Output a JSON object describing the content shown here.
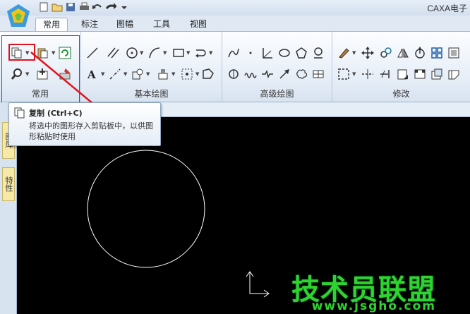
{
  "window": {
    "title": "CAXA电子",
    "quick_access": [
      "new-icon",
      "open-icon",
      "save-icon",
      "print-icon",
      "undo-icon",
      "redo-icon",
      "customize-icon"
    ]
  },
  "tabs": [
    {
      "label": "常用",
      "active": true
    },
    {
      "label": "标注"
    },
    {
      "label": "图幅"
    },
    {
      "label": "工具"
    },
    {
      "label": "视图"
    }
  ],
  "ribbon": {
    "groups": [
      {
        "label": "常用"
      },
      {
        "label": "基本绘图"
      },
      {
        "label": "高级绘图"
      },
      {
        "label": "修改"
      }
    ]
  },
  "tooltip": {
    "title": "复制 (Ctrl+C)",
    "description": "将选中的图形存入剪贴板中，以供图形粘贴时使用"
  },
  "sidebar": {
    "tabs": [
      "图库",
      "特性"
    ]
  },
  "watermark": {
    "text": "技术员联盟",
    "url": "www.jsgho.com"
  },
  "colors": {
    "highlight": "#e2121c",
    "canvas": "#000000",
    "watermark": "#2fd22f"
  }
}
